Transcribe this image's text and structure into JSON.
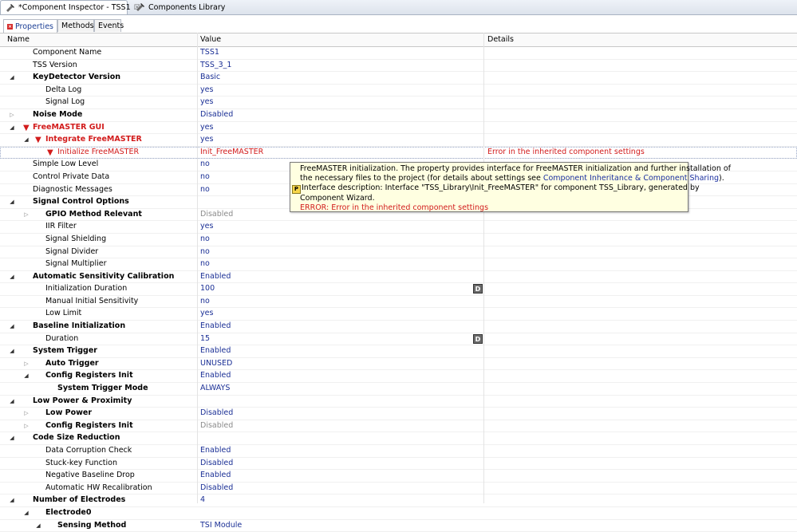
{
  "editor_tabs": [
    {
      "label": "*Component Inspector - TSS1",
      "close": "☒"
    },
    {
      "label": "Components Library"
    }
  ],
  "inner_tabs": [
    "Properties",
    "Methods",
    "Events"
  ],
  "columns": {
    "name": "Name",
    "value": "Value",
    "details": "Details"
  },
  "rows": [
    {
      "name": "Component Name",
      "value": "TSS1"
    },
    {
      "name": "TSS Version",
      "value": "TSS_3_1"
    },
    {
      "name": "KeyDetector Version",
      "value": "Basic"
    },
    {
      "name": "Delta Log",
      "value": "yes"
    },
    {
      "name": "Signal Log",
      "value": "yes"
    },
    {
      "name": "Noise Mode",
      "value": "Disabled"
    },
    {
      "name": "FreeMASTER GUI",
      "value": "yes"
    },
    {
      "name": "Integrate FreeMASTER",
      "value": "yes"
    },
    {
      "name": "Initialize FreeMASTER",
      "value": "Init_FreeMASTER",
      "details": "Error in the inherited component settings"
    },
    {
      "name": "Simple Low Level",
      "value": "no"
    },
    {
      "name": "Control Private Data",
      "value": "no"
    },
    {
      "name": "Diagnostic Messages",
      "value": "no"
    },
    {
      "name": "Signal Control Options",
      "value": ""
    },
    {
      "name": "GPIO Method Relevant",
      "value": "Disabled"
    },
    {
      "name": "IIR Filter",
      "value": "yes"
    },
    {
      "name": "Signal Shielding",
      "value": "no"
    },
    {
      "name": "Signal Divider",
      "value": "no"
    },
    {
      "name": "Signal Multiplier",
      "value": "no"
    },
    {
      "name": "Automatic Sensitivity Calibration",
      "value": "Enabled"
    },
    {
      "name": "Initialization Duration",
      "value": "100",
      "button": "D"
    },
    {
      "name": "Manual Initial Sensitivity",
      "value": "no"
    },
    {
      "name": "Low Limit",
      "value": "yes"
    },
    {
      "name": "Baseline Initialization",
      "value": "Enabled"
    },
    {
      "name": "Duration",
      "value": "15",
      "button": "D"
    },
    {
      "name": "System Trigger",
      "value": "Enabled"
    },
    {
      "name": "Auto Trigger",
      "value": "UNUSED"
    },
    {
      "name": "Config Registers Init",
      "value": "Enabled"
    },
    {
      "name": "System Trigger Mode",
      "value": "ALWAYS"
    },
    {
      "name": "Low Power & Proximity",
      "value": ""
    },
    {
      "name": "Low Power",
      "value": "Disabled"
    },
    {
      "name": "Config Registers Init",
      "value": "Disabled"
    },
    {
      "name": "Code Size Reduction",
      "value": ""
    },
    {
      "name": "Data Corruption Check",
      "value": "Enabled"
    },
    {
      "name": "Stuck-key Function",
      "value": "Disabled"
    },
    {
      "name": "Negative Baseline Drop",
      "value": "Enabled"
    },
    {
      "name": "Automatic HW Recalibration",
      "value": "Disabled"
    },
    {
      "name": "Number of Electrodes",
      "value": "4"
    },
    {
      "name": "Electrode0",
      "value": ""
    },
    {
      "name": "Sensing Method",
      "value": "TSI Module"
    }
  ],
  "tooltip": {
    "line1": "FreeMASTER initialization. The property provides interface for FreeMASTER initialization and further installation of",
    "line2a": "the necessary files to the project (for details about settings see ",
    "line2_link": "Component Inheritance & Component Sharing",
    "line2b": ").",
    "p_icon": "P",
    "line3": "Interface description: Interface \"TSS_Library\\Init_FreeMASTER\" for component TSS_Library, generated by",
    "line4": "Component Wizard.",
    "line5": "ERROR: Error in the inherited component settings"
  },
  "colors": {
    "value_text": "#1a2f95",
    "error_text": "#d21c1c",
    "tooltip_bg": "#ffffe1"
  }
}
